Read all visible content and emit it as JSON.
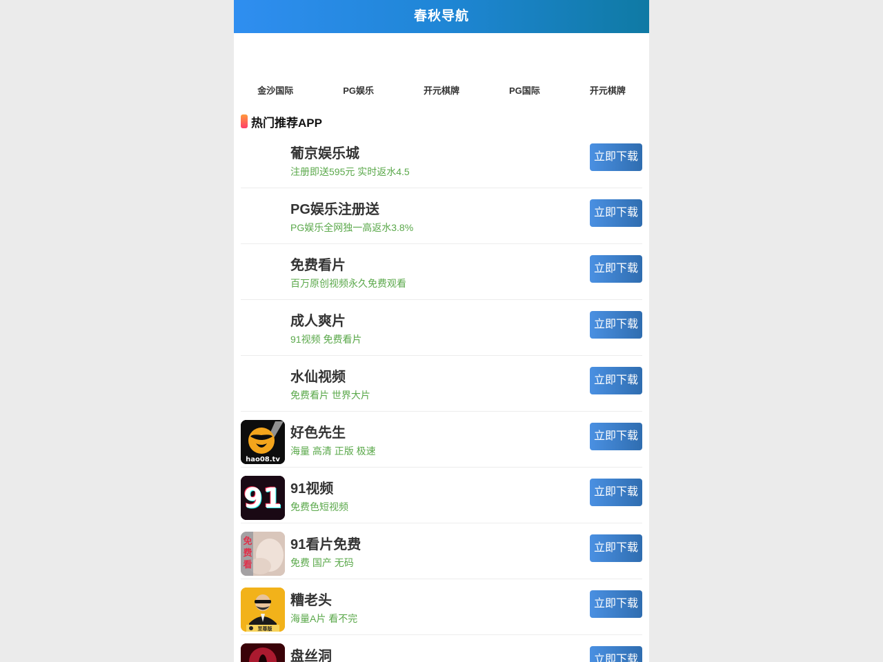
{
  "header": {
    "title": "春秋导航"
  },
  "nav": {
    "items": [
      {
        "label": "金沙国际"
      },
      {
        "label": "PG娱乐"
      },
      {
        "label": "开元棋牌"
      },
      {
        "label": "PG国际"
      },
      {
        "label": "开元棋牌"
      }
    ]
  },
  "section": {
    "title": "热门推荐APP"
  },
  "apps": [
    {
      "name": "葡京娱乐城",
      "desc": "注册即送595元 实时返水4.5",
      "button": "立即下载",
      "icon": "none"
    },
    {
      "name": "PG娱乐注册送",
      "desc": "PG娱乐全网独一高返水3.8%",
      "button": "立即下载",
      "icon": "none"
    },
    {
      "name": "免费看片",
      "desc": "百万原创视频永久免费观看",
      "button": "立即下载",
      "icon": "none"
    },
    {
      "name": "成人爽片",
      "desc": "91视频 免费看片",
      "button": "立即下载",
      "icon": "none"
    },
    {
      "name": "水仙视频",
      "desc": "免费看片 世界大片",
      "button": "立即下载",
      "icon": "none"
    },
    {
      "name": "好色先生",
      "desc": "海量 高清 正版 极速",
      "button": "立即下载",
      "icon": "hao-logo-icon",
      "icon_text": "hao08.tv"
    },
    {
      "name": "91视频",
      "desc": "免费色短视频",
      "button": "立即下载",
      "icon": "91-logo-icon",
      "icon_text": "91"
    },
    {
      "name": "91看片免费",
      "desc": "免费 国产 无码",
      "button": "立即下载",
      "icon": "free-watch-icon",
      "icon_text": "免费看"
    },
    {
      "name": "糟老头",
      "desc": "海量A片 看不完",
      "button": "立即下载",
      "icon": "old-man-icon",
      "icon_text": "至尊版"
    },
    {
      "name": "盘丝洞",
      "desc": "",
      "button": "立即下载",
      "icon": "psd-icon"
    }
  ],
  "colors": {
    "header_start": "#2f8ef0",
    "header_end": "#0f7aa4",
    "button": "#3f82d0",
    "desc_green": "#5aa84a"
  }
}
